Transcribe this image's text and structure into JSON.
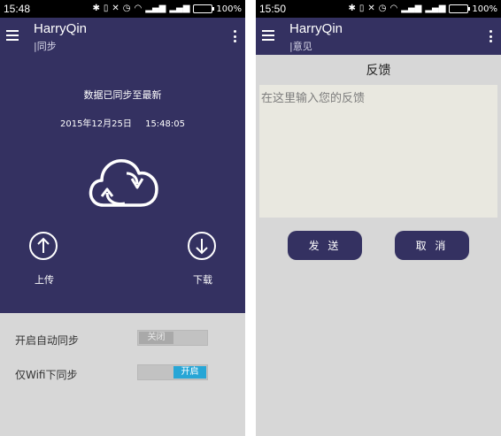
{
  "left_screen": {
    "status_bar": {
      "time": "15:48",
      "battery": "100%"
    },
    "app_bar": {
      "title": "HarryQin",
      "subtitle": "|同步"
    },
    "sync": {
      "status_text": "数据已同步至最新",
      "date": "2015年12月25日",
      "time": "15:48:05",
      "upload_label": "上传",
      "download_label": "下载"
    },
    "settings": [
      {
        "label": "开启自动同步",
        "toggle_text": "关闭",
        "state": "off"
      },
      {
        "label": "仅Wifi下同步",
        "toggle_text": "开启",
        "state": "on"
      }
    ]
  },
  "right_screen": {
    "status_bar": {
      "time": "15:50",
      "battery": "100%"
    },
    "app_bar": {
      "title": "HarryQin",
      "subtitle": "|意见"
    },
    "feedback": {
      "title": "反馈",
      "placeholder": "在这里输入您的反馈",
      "send_label": "发 送",
      "cancel_label": "取 消"
    }
  },
  "colors": {
    "primary": "#343161",
    "background": "#d7d7d7",
    "toggle_on": "#27a6d6",
    "battery": "#37d24a"
  },
  "icons": [
    "menu-icon",
    "overflow-icon",
    "cloud-sync-icon",
    "upload-arrow-icon",
    "download-arrow-icon",
    "wifi-icon",
    "signal-icon",
    "alarm-icon",
    "bluetooth-icon"
  ]
}
